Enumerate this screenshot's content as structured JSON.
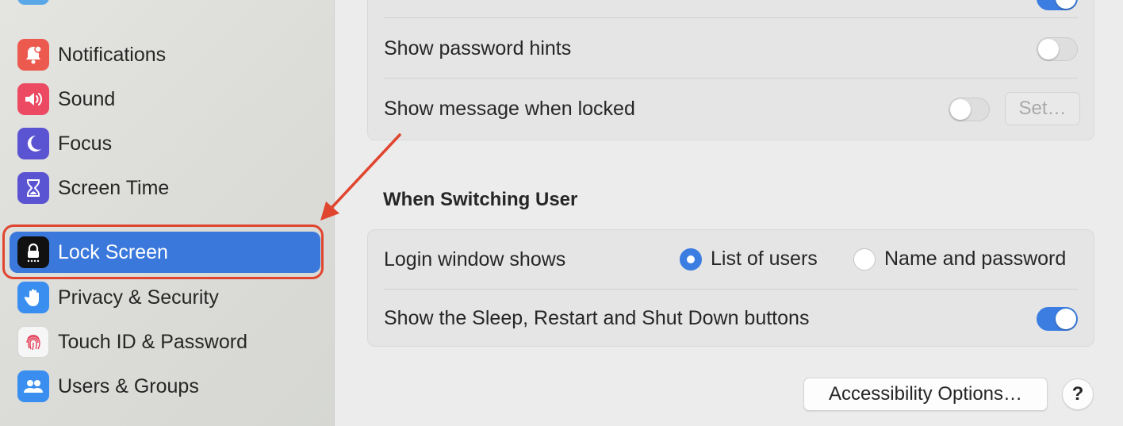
{
  "sidebar": {
    "items": [
      {
        "label": "Notifications",
        "icon": "bell-icon",
        "color": "#ec5a4f"
      },
      {
        "label": "Sound",
        "icon": "speaker-icon",
        "color": "#ec4a63"
      },
      {
        "label": "Focus",
        "icon": "moon-icon",
        "color": "#5b54d2"
      },
      {
        "label": "Screen Time",
        "icon": "hourglass-icon",
        "color": "#5b54d2"
      },
      {
        "label": "Lock Screen",
        "icon": "lock-icon",
        "color": "#111111",
        "selected": true
      },
      {
        "label": "Privacy & Security",
        "icon": "hand-icon",
        "color": "#3a8ef0"
      },
      {
        "label": "Touch ID & Password",
        "icon": "fingerprint-icon",
        "color": "#f6f6f6"
      },
      {
        "label": "Users & Groups",
        "icon": "users-icon",
        "color": "#3a8ef0"
      }
    ]
  },
  "top_card": {
    "password_hints_label": "Show password hints",
    "password_hints_on": false,
    "message_locked_label": "Show message when locked",
    "message_locked_on": false,
    "set_button_label": "Set…"
  },
  "switching": {
    "section_title": "When Switching User",
    "login_window_label": "Login window shows",
    "options": [
      {
        "label": "List of users",
        "checked": true
      },
      {
        "label": "Name and password",
        "checked": false
      }
    ],
    "sleep_buttons_label": "Show the Sleep, Restart and Shut Down buttons",
    "sleep_buttons_on": true
  },
  "footer": {
    "accessibility_button_label": "Accessibility Options…",
    "help_label": "?"
  },
  "colors": {
    "accent": "#3b7de0",
    "selection": "#3a78db",
    "annotation": "#e0452f"
  }
}
